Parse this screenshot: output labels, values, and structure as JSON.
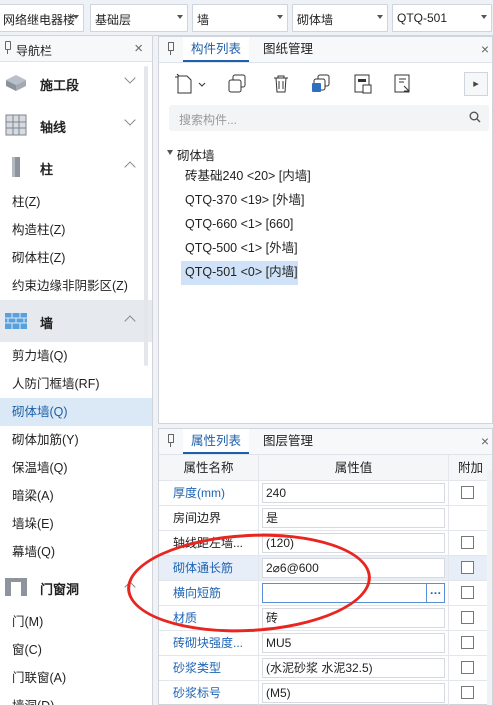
{
  "topbar": {
    "dropdowns": [
      {
        "value": "网络继电器楼"
      },
      {
        "value": "基础层"
      },
      {
        "value": "墙"
      },
      {
        "value": "砌体墙"
      },
      {
        "value": "QTQ-501"
      }
    ]
  },
  "nav": {
    "title": "导航栏",
    "categories": [
      {
        "label": "施工段",
        "icon": "construction-segment-icon"
      },
      {
        "label": "轴线",
        "icon": "axis-grid-icon"
      },
      {
        "label": "柱",
        "icon": "column-icon"
      },
      {
        "label": "墙",
        "icon": "wall-brick-icon"
      },
      {
        "label": "门窗洞",
        "icon": "door-window-icon"
      }
    ],
    "column_items": [
      "柱(Z)",
      "构造柱(Z)",
      "砌体柱(Z)",
      "约束边缘非阴影区(Z)"
    ],
    "wall_items": [
      "剪力墙(Q)",
      "人防门框墙(RF)",
      "砌体墙(Q)",
      "砌体加筋(Y)",
      "保温墙(Q)",
      "暗梁(A)",
      "墙垛(E)",
      "幕墙(Q)"
    ],
    "door_items": [
      "门(M)",
      "窗(C)",
      "门联窗(A)",
      "墙洞(D)"
    ]
  },
  "component_panel": {
    "tabs": [
      "构件列表",
      "图纸管理"
    ],
    "search_placeholder": "搜索构件...",
    "tree_root": "砌体墙",
    "items": [
      "砖基础240 <20> [内墙]",
      "QTQ-370 <19> [外墙]",
      "QTQ-660 <1> [660]",
      "QTQ-500 <1> [外墙]",
      "QTQ-501 <0> [内墙]"
    ],
    "selected_index": 4,
    "toolbar_icons": [
      "new-component-icon",
      "copy-icon",
      "delete-icon",
      "copy-layer-icon",
      "floor-copy-icon",
      "import-icon"
    ],
    "more_label": "▸"
  },
  "property_panel": {
    "tabs": [
      "属性列表",
      "图层管理"
    ],
    "headers": {
      "name": "属性名称",
      "value": "属性值",
      "add": "附加"
    },
    "rows": [
      {
        "name": "厚度(mm)",
        "value": "240",
        "blue": true,
        "checkbox": true
      },
      {
        "name": "房间边界",
        "value": "是",
        "blue": false,
        "checkbox": false
      },
      {
        "name": "轴线距左墙...",
        "value": "(120)",
        "blue": false,
        "checkbox": true
      },
      {
        "name": "砌体通长筋",
        "value": "2⌀6@600",
        "blue": true,
        "checkbox": true
      },
      {
        "name": "横向短筋",
        "value": "",
        "blue": true,
        "checkbox": true
      },
      {
        "name": "材质",
        "value": "砖",
        "blue": true,
        "checkbox": true
      },
      {
        "name": "砖砌块强度...",
        "value": "MU5",
        "blue": true,
        "checkbox": true
      },
      {
        "name": "砂浆类型",
        "value": "(水泥砂浆 水泥32.5)",
        "blue": true,
        "checkbox": true
      },
      {
        "name": "砂浆标号",
        "value": "(M5)",
        "blue": true,
        "checkbox": true
      }
    ],
    "highlight_color": "#e8251f"
  }
}
